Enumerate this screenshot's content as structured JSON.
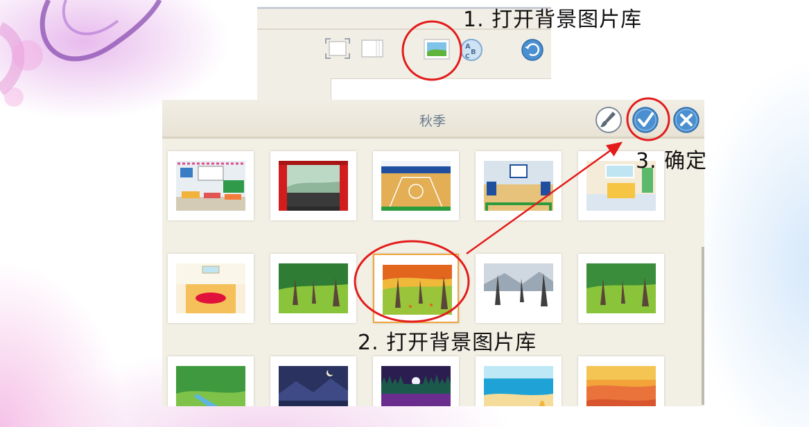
{
  "annotations": {
    "step1": "1. 打开背景图片库",
    "step2": "2. 打开背景图片库",
    "step3": "3. 确定"
  },
  "library": {
    "title": "秋季",
    "buttons": [
      "paint-brush-icon",
      "checkmark-icon",
      "close-icon"
    ]
  },
  "toolbar": {
    "icons": [
      "fullscreen-icon",
      "page-view-icon",
      "background-library-icon",
      "text-abc-icon",
      "reset-icon"
    ]
  },
  "thumbnails": [
    {
      "scene": "classroom"
    },
    {
      "scene": "theater-stage"
    },
    {
      "scene": "basketball-court"
    },
    {
      "scene": "gym-basketball"
    },
    {
      "scene": "bedroom"
    },
    {
      "scene": "empty-room-red-rug"
    },
    {
      "scene": "green-forest"
    },
    {
      "scene": "autumn-forest",
      "selected": true
    },
    {
      "scene": "winter-forest"
    },
    {
      "scene": "summer-forest"
    },
    {
      "scene": "river-valley"
    },
    {
      "scene": "night-mountains"
    },
    {
      "scene": "night-forest"
    },
    {
      "scene": "beach"
    },
    {
      "scene": "sunset"
    }
  ],
  "colors": {
    "annotation_red": "#e31b1b",
    "selected_border": "#f0a43b",
    "header_button_blue": "#4a8fd0"
  }
}
